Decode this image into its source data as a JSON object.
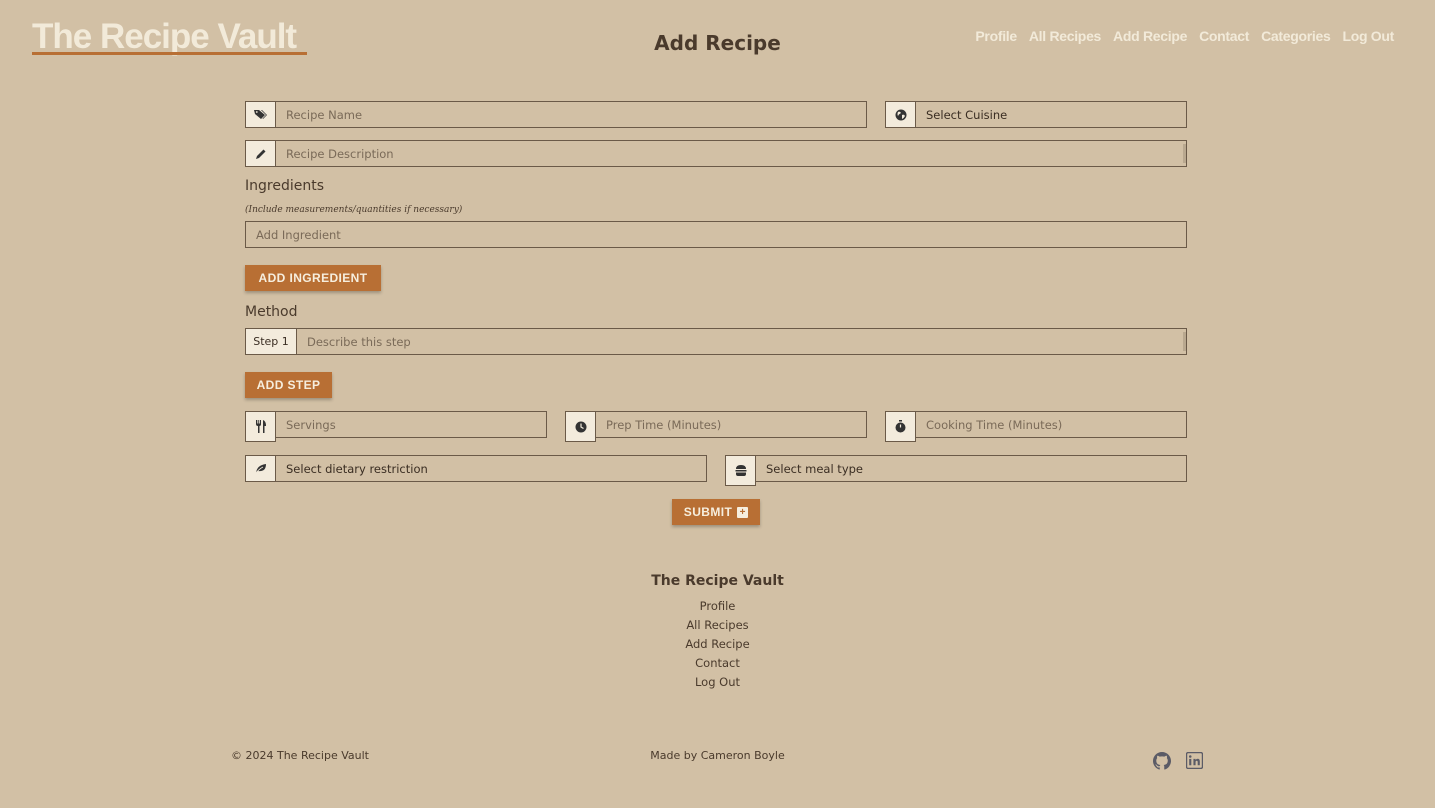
{
  "header": {
    "brand": "The Recipe Vault",
    "page_title": "Add Recipe",
    "nav": [
      "Profile",
      "All Recipes",
      "Add Recipe",
      "Contact",
      "Categories",
      "Log Out"
    ]
  },
  "form": {
    "recipe_name_placeholder": "Recipe Name",
    "cuisine_select": "Select Cuisine",
    "description_placeholder": "Recipe Description",
    "ingredients_heading": "Ingredients",
    "ingredients_hint": "(Include measurements/quantities if necessary)",
    "ingredient_placeholder": "Add Ingredient",
    "add_ingredient_button": "ADD INGREDIENT",
    "method_heading": "Method",
    "step_label": "Step 1",
    "step_placeholder": "Describe this step",
    "add_step_button": "ADD STEP",
    "servings_placeholder": "Servings",
    "prep_time_placeholder": "Prep Time (Minutes)",
    "cooking_time_placeholder": "Cooking Time (Minutes)",
    "dietary_select": "Select dietary restriction",
    "meal_type_select": "Select meal type",
    "submit_button": "SUBMIT"
  },
  "footer": {
    "title": "The Recipe Vault",
    "links": [
      "Profile",
      "All Recipes",
      "Add Recipe",
      "Contact",
      "Log Out"
    ],
    "copyright": "© 2024 The Recipe Vault",
    "made_by": "Made by Cameron Boyle"
  },
  "colors": {
    "background": "#d2c0a5",
    "accent": "#b86f34",
    "nav_text": "#f2ead9",
    "text": "#4a3a2c"
  },
  "icons": {
    "recipe_name": "tags-icon",
    "cuisine": "globe-icon",
    "description": "pencil-icon",
    "servings": "utensils-icon",
    "prep_time": "clock-icon",
    "cooking_time": "stopwatch-icon",
    "dietary": "leaf-icon",
    "meal_type": "burger-icon",
    "github": "github-icon",
    "linkedin": "linkedin-icon"
  }
}
